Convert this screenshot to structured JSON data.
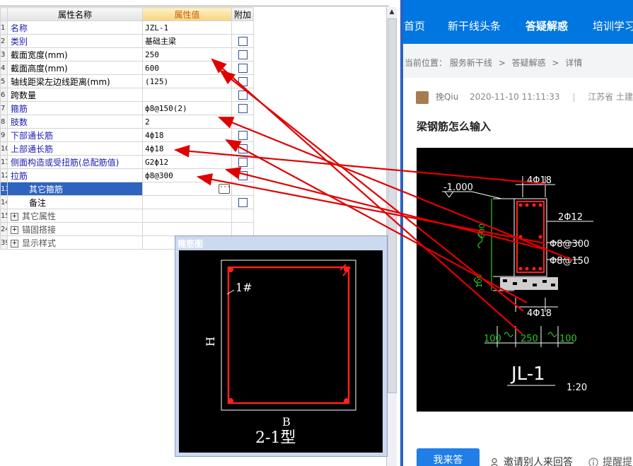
{
  "grid": {
    "headers": {
      "name": "属性名称",
      "value": "属性值",
      "extra": "附加"
    },
    "rows": [
      {
        "num": "1",
        "name": "名称",
        "value": "JZL-1",
        "check": false
      },
      {
        "num": "2",
        "name": "类别",
        "value": "基础主梁",
        "check": true
      },
      {
        "num": "3",
        "name": "截面宽度(mm)",
        "value": "250",
        "check": true
      },
      {
        "num": "4",
        "name": "截面高度(mm)",
        "value": "600",
        "check": true
      },
      {
        "num": "5",
        "name": "轴线距梁左边线距离(mm)",
        "value": "(125)",
        "check": true
      },
      {
        "num": "6",
        "name": "跨数量",
        "value": "",
        "check": true
      },
      {
        "num": "7",
        "name": "箍筋",
        "value": "ф8@150(2)",
        "check": true
      },
      {
        "num": "8",
        "name": "肢数",
        "value": "2",
        "check": false
      },
      {
        "num": "9",
        "name": "下部通长筋",
        "value": "4ф18",
        "check": true
      },
      {
        "num": "10",
        "name": "上部通长筋",
        "value": "4ф18",
        "check": true
      },
      {
        "num": "11",
        "name": "侧面构造或受扭筋(总配筋值)",
        "value": "G2ф12",
        "check": true
      },
      {
        "num": "12",
        "name": "拉筋",
        "value": "ф8@300",
        "check": true
      },
      {
        "num": "13",
        "name": "其它箍筋",
        "value": "",
        "check": false
      },
      {
        "num": "14",
        "name": "备注",
        "value": "",
        "check": true
      },
      {
        "num": "15",
        "name": "其它属性",
        "value": "",
        "check": false
      },
      {
        "num": "24",
        "name": "锚固搭接",
        "value": "",
        "check": false
      },
      {
        "num": "39",
        "name": "显示样式",
        "value": "",
        "check": false
      }
    ],
    "expand_symbol": "+",
    "dots_label": "···"
  },
  "popup": {
    "title": "箍筋图",
    "label_1": "1#",
    "label_h": "H",
    "label_b": "B",
    "type_label": "2-1型"
  },
  "nav": {
    "items": [
      "首页",
      "新干线头条",
      "答疑解惑",
      "培训学习"
    ]
  },
  "breadcrumb": {
    "prefix": "当前位置：",
    "items": [
      "服务新干线",
      "答疑解惑",
      "详情"
    ],
    "sep": ">"
  },
  "post": {
    "user": "挽Qiu",
    "time": "2020-11-10 11:11:33",
    "divider": "|",
    "province": "江苏省",
    "category": "土建 訁",
    "title": "梁钢筋怎么输入"
  },
  "drawing": {
    "top_bars": "4Φ18",
    "elevation": "-1.000",
    "side_bars": "2Φ12",
    "tie": "Φ8@300",
    "stirrup": "Φ8@150",
    "bottom_bars": "4Φ18",
    "height": "600",
    "cover": "100",
    "left_dim": "100",
    "width_dim": "250",
    "right_dim": "100",
    "beam_name": "JL-1",
    "scale": "1:20"
  },
  "actions": {
    "answer": "我来答",
    "invite": "邀请别人来回答",
    "remind": "提醒提"
  },
  "colors": {
    "nav_bg": "#0076e0",
    "accent": "#1f7ee8",
    "arrow": "#e00000",
    "selected_row": "#2f63c0"
  }
}
